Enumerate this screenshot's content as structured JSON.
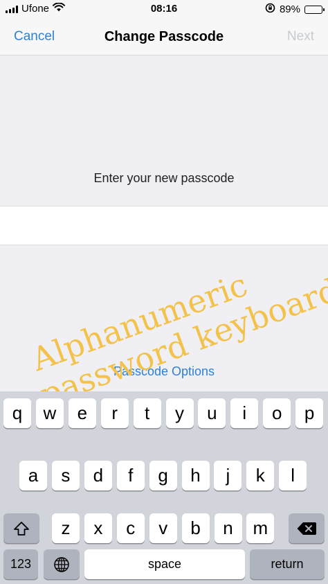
{
  "status_bar": {
    "carrier": "Ufone",
    "time": "08:16",
    "battery": "89%",
    "battery_level": 0.89,
    "icons": [
      "signal-icon",
      "wifi-icon",
      "orientation-lock-icon",
      "battery-icon"
    ]
  },
  "nav": {
    "cancel": "Cancel",
    "title": "Change Passcode",
    "next": "Next"
  },
  "main": {
    "prompt": "Enter your new passcode",
    "input_value": "",
    "options_link": "Passcode Options"
  },
  "annotation": {
    "line1": "Alphanumeric",
    "line2": "password keyboard",
    "color": "#f3c24a"
  },
  "keyboard": {
    "row1": [
      "q",
      "w",
      "e",
      "r",
      "t",
      "y",
      "u",
      "i",
      "o",
      "p"
    ],
    "row2": [
      "a",
      "s",
      "d",
      "f",
      "g",
      "h",
      "j",
      "k",
      "l"
    ],
    "row3": [
      "z",
      "x",
      "c",
      "v",
      "b",
      "n",
      "m"
    ],
    "numbers_key": "123",
    "space_key": "space",
    "return_key": "return",
    "icons": [
      "shift-icon",
      "delete-icon",
      "globe-icon"
    ]
  },
  "colors": {
    "accent": "#2f7fd2",
    "disabled": "#c7cbd1",
    "keyboard_bg": "#d1d4da"
  }
}
